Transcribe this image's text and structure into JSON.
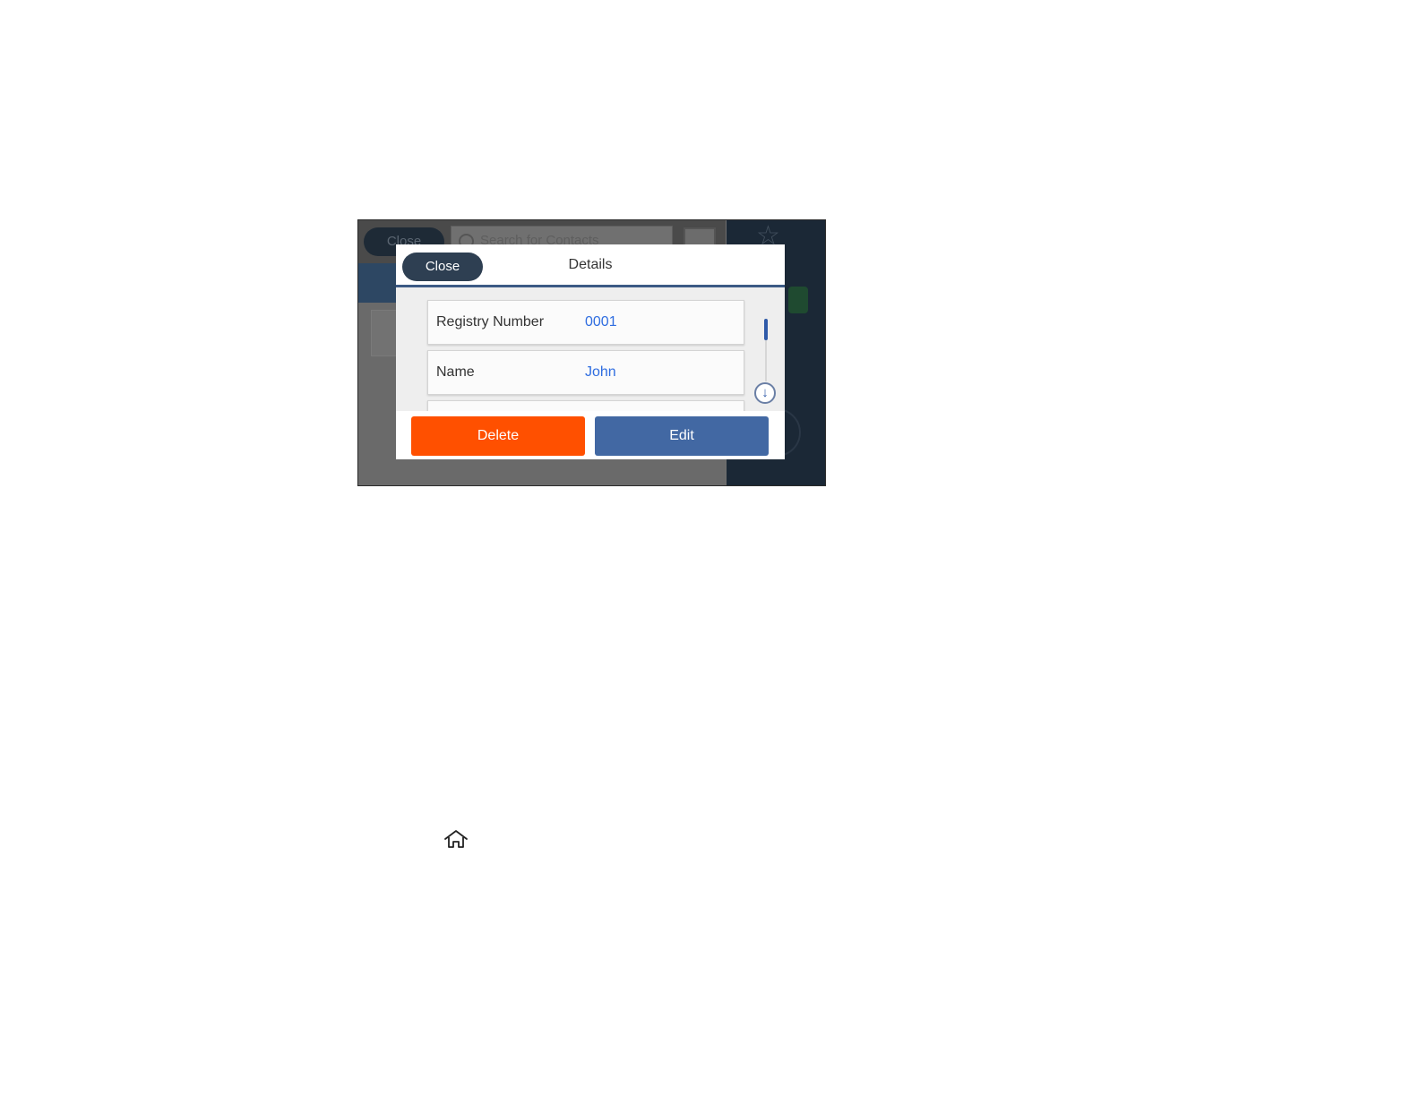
{
  "background": {
    "close_label": "Close",
    "search_placeholder": "Search for Contacts"
  },
  "dialog": {
    "close_label": "Close",
    "title": "Details",
    "rows": [
      {
        "label": "Registry Number",
        "value": "0001"
      },
      {
        "label": "Name",
        "value": "John"
      }
    ],
    "delete_label": "Delete",
    "edit_label": "Edit"
  },
  "colors": {
    "delete": "#ff5000",
    "edit": "#4268a3",
    "value_text": "#2f6de0",
    "header_line": "#3c5a85"
  },
  "icons": [
    "search-icon",
    "contact-card-icon",
    "star-icon",
    "arrow-down-icon",
    "home-icon"
  ]
}
